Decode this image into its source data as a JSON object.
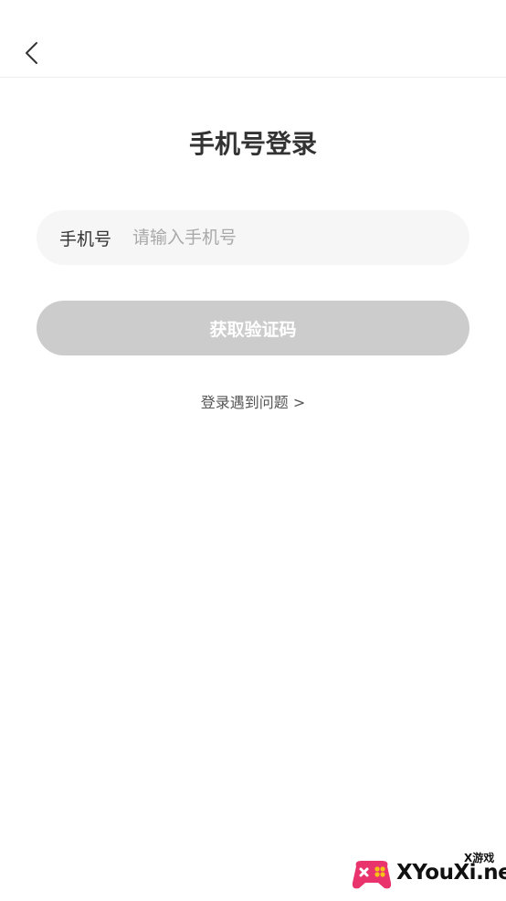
{
  "nav": {
    "back_icon": "chevron-left-icon"
  },
  "page": {
    "title": "手机号登录"
  },
  "phone_field": {
    "label": "手机号",
    "value": "",
    "placeholder": "请输入手机号"
  },
  "get_code_button": {
    "label": "获取验证码",
    "background_color": "#cccccc",
    "text_color": "#ffffff"
  },
  "help_link": {
    "label": "登录遇到问题 >"
  },
  "watermark": {
    "small_text": "X游戏",
    "main_text": "XYouXi.net",
    "icon": "gamepad-logo-icon"
  }
}
